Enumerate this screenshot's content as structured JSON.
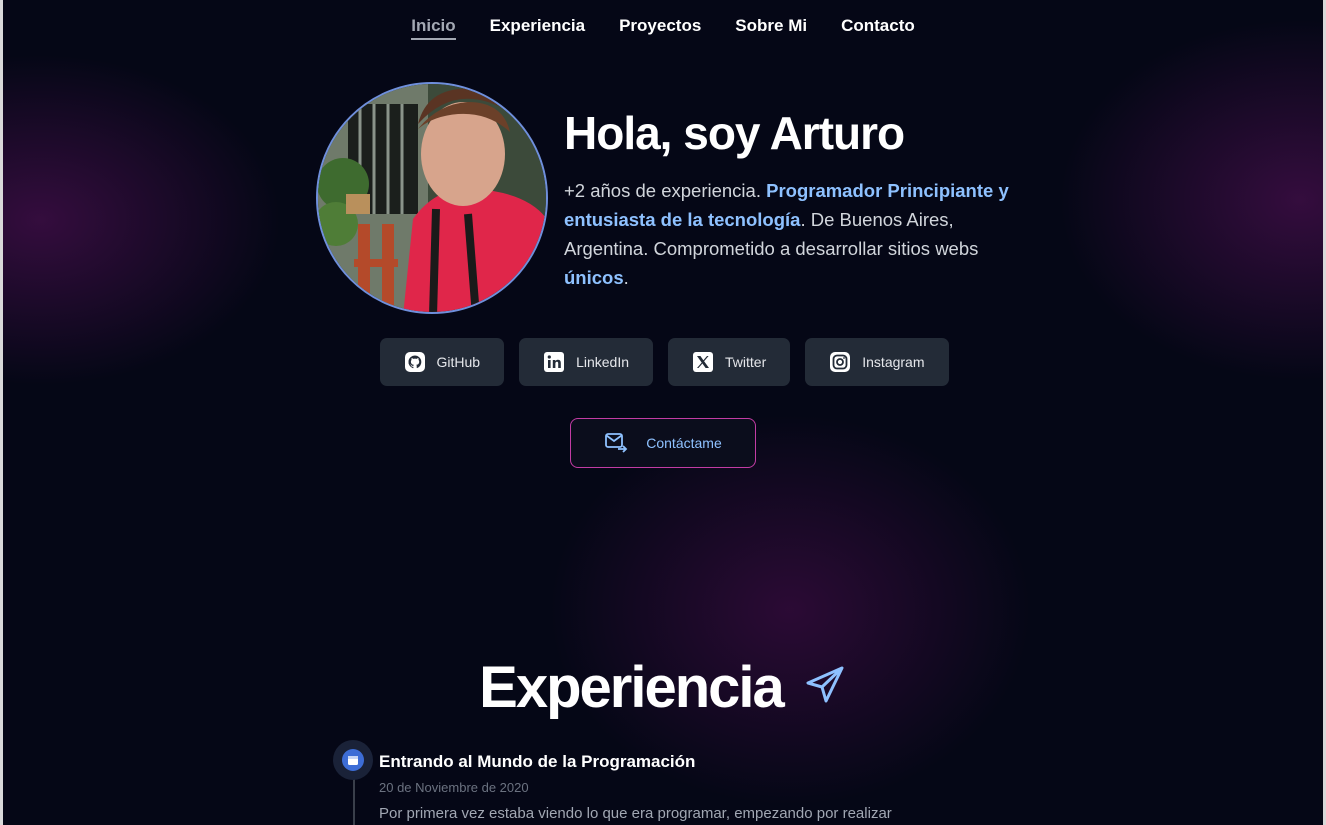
{
  "nav": {
    "items": [
      {
        "label": "Inicio",
        "active": true
      },
      {
        "label": "Experiencia",
        "active": false
      },
      {
        "label": "Proyectos",
        "active": false
      },
      {
        "label": "Sobre Mi",
        "active": false
      },
      {
        "label": "Contacto",
        "active": false
      }
    ]
  },
  "hero": {
    "title": "Hola, soy Arturo",
    "desc_1": "+2 años de experiencia. ",
    "desc_highlight_1": "Programador Principiante y entusiasta de la tecnología",
    "desc_2": ". De Buenos Aires, Argentina. Comprometido a desarrollar sitios webs ",
    "desc_highlight_2": "únicos",
    "desc_3": ".",
    "accent_color": "#8ec1ff"
  },
  "socials": [
    {
      "label": "GitHub",
      "icon": "github-icon"
    },
    {
      "label": "LinkedIn",
      "icon": "linkedin-icon"
    },
    {
      "label": "Twitter",
      "icon": "x-twitter-icon"
    },
    {
      "label": "Instagram",
      "icon": "instagram-icon"
    }
  ],
  "contact": {
    "label": "Contáctame",
    "icon": "mail-send-icon",
    "border_color": "#c23ca4"
  },
  "experience": {
    "heading": "Experiencia",
    "heading_icon": "paper-plane-icon",
    "items": [
      {
        "title": "Entrando al Mundo de la Programación",
        "date": "20 de Noviembre de 2020",
        "description": "Por primera vez estaba viendo lo que era programar, empezando por realizar",
        "icon": "calendar-icon"
      }
    ]
  },
  "colors": {
    "background": "#050716",
    "glow": "#6e146e"
  }
}
